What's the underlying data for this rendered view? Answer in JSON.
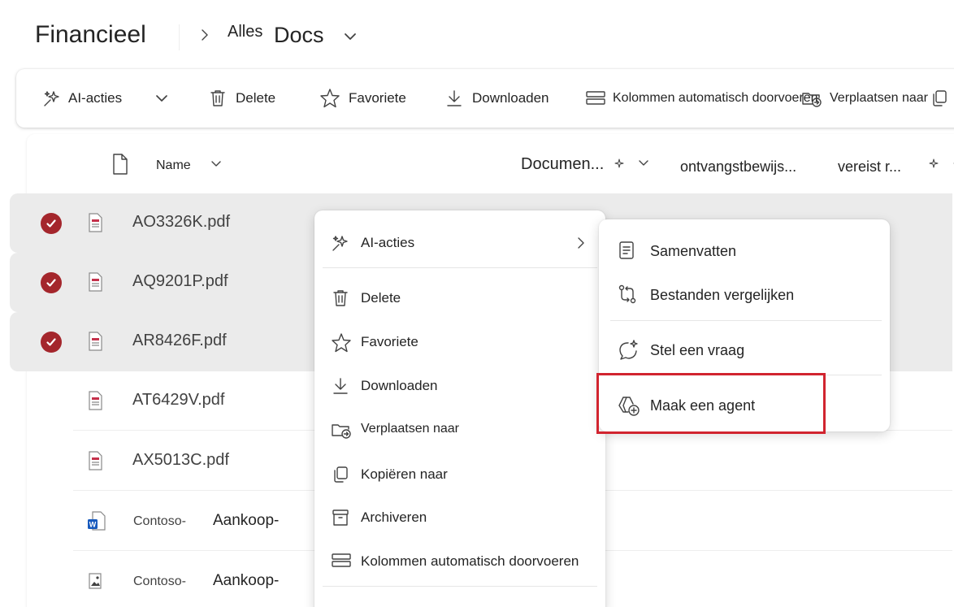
{
  "header": {
    "site_title": "Financieel",
    "breadcrumb_part1": "Alles",
    "breadcrumb_part2": "Docs"
  },
  "toolbar": {
    "ai_actions": "AI-acties",
    "delete": "Delete",
    "favorite": "Favoriete",
    "download": "Downloaden",
    "autofill_columns": "Kolommen automatisch doorvoeren",
    "move_to": "Verplaatsen naar"
  },
  "columns": {
    "name": "Name",
    "document": "Documen...",
    "receipt": "ontvangstbewijs...",
    "required": "vereist r..."
  },
  "files": [
    {
      "name": "AO3326K.pdf",
      "selected": true,
      "type": "pdf"
    },
    {
      "name": "AQ9201P.pdf",
      "selected": true,
      "type": "pdf"
    },
    {
      "name": "AR8426F.pdf",
      "selected": true,
      "type": "pdf"
    },
    {
      "name": "AT6429V.pdf",
      "selected": false,
      "type": "pdf"
    },
    {
      "name": "AX5013C.pdf",
      "selected": false,
      "type": "pdf"
    },
    {
      "name_a": "Contoso-",
      "name_b": "Aankoop-",
      "selected": false,
      "type": "word"
    },
    {
      "name_a": "Contoso-",
      "name_b": "Aankoop-",
      "selected": false,
      "type": "image"
    }
  ],
  "context_menu": {
    "ai_actions": "AI-acties",
    "delete": "Delete",
    "favorite": "Favoriete",
    "download": "Downloaden",
    "move_to": "Verplaatsen naar",
    "copy_to": "Kopiëren naar",
    "archive": "Archiveren",
    "autofill_columns": "Kolommen automatisch doorvoeren"
  },
  "submenu": {
    "summarize": "Samenvatten",
    "compare_files": "Bestanden vergelijken",
    "ask_question": "Stel een vraag",
    "create_agent": "Maak een agent"
  },
  "colors": {
    "selected_check": "#a4262c",
    "selected_row": "#ebebeb",
    "highlight_border": "#d1242f",
    "pdf_icon": "#c4314b",
    "word_icon": "#185abd"
  }
}
